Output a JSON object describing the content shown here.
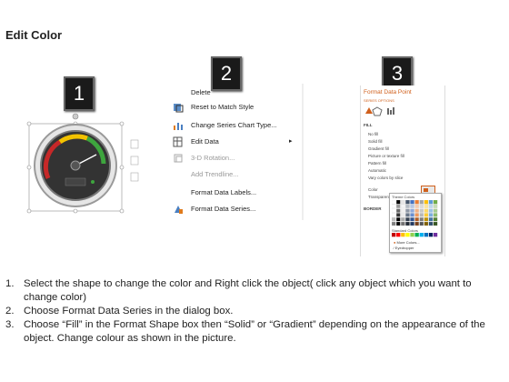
{
  "title": "Edit Color",
  "steps": {
    "s1": "1",
    "s2": "2",
    "s3": "3"
  },
  "context_menu": {
    "items": [
      {
        "label": "Delete",
        "disabled": false,
        "icon": "delete-icon"
      },
      {
        "label": "Reset to Match Style",
        "disabled": false,
        "icon": "reset-style-icon"
      },
      {
        "label": "Change Series Chart Type...",
        "disabled": false,
        "icon": "chart-type-icon"
      },
      {
        "label": "Edit Data",
        "disabled": false,
        "icon": "edit-data-icon",
        "submenu": true
      },
      {
        "label": "3-D Rotation...",
        "disabled": true,
        "icon": "rotation-icon"
      },
      {
        "label": "Add Trendline...",
        "disabled": true,
        "icon": ""
      },
      {
        "label": "Format Data Labels...",
        "disabled": false,
        "icon": ""
      },
      {
        "label": "Format Data Series...",
        "disabled": false,
        "icon": "format-series-icon"
      }
    ]
  },
  "format_pane": {
    "title": "Format Data Point",
    "subtitle": "SERIES OPTIONS",
    "fill_section": "FILL",
    "fill_options": [
      "No fill",
      "Solid fill",
      "Gradient fill",
      "Picture or texture fill",
      "Pattern fill",
      "Automatic",
      "Vary colors by slice"
    ],
    "selected_fill": "Solid fill",
    "color_label": "Color",
    "transparency_label": "Transparency",
    "border_section": "BORDER",
    "palette": {
      "theme_label": "Theme Colors",
      "standard_label": "Standard Colors",
      "more_colors": "More Colors...",
      "eyedropper": "Eyedropper"
    }
  },
  "instructions": [
    {
      "num": "1.",
      "text": "Select the shape to change the color and Right click the object( click any object which you want to change color)"
    },
    {
      "num": "2.",
      "text": "Choose Format Data Series in the dialog box."
    },
    {
      "num": "3.",
      "text": "Choose “Fill” in the Format Shape box then “Solid” or “Gradient” depending on the appearance of the object. Change colour as shown in the picture."
    }
  ],
  "colors": {
    "accent": "#d0601c",
    "step_box": "#1a1a1a"
  }
}
